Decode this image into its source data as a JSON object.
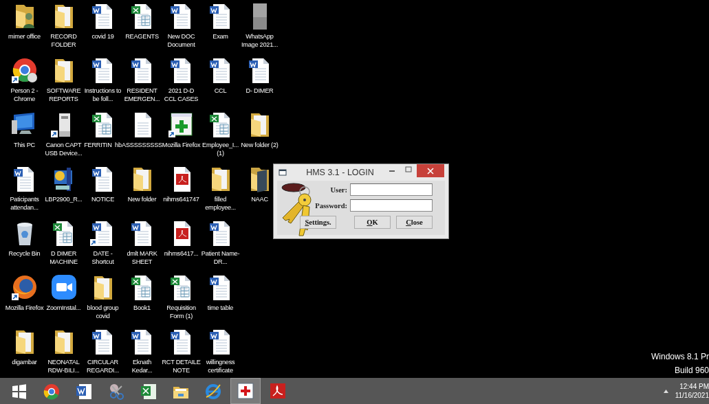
{
  "desktop": {
    "rows": [
      [
        {
          "label": "mimer office",
          "kind": "user-folder",
          "shortcut": false
        },
        {
          "label": "RECORD FOLDER",
          "kind": "folder",
          "shortcut": false
        },
        {
          "label": "covid 19",
          "kind": "word",
          "shortcut": false
        },
        {
          "label": "REAGENTS",
          "kind": "excel",
          "shortcut": false
        },
        {
          "label": "New DOC Document",
          "kind": "word",
          "shortcut": false
        },
        {
          "label": "Exam",
          "kind": "word",
          "shortcut": false
        },
        {
          "label": "WhatsApp Image 2021...",
          "kind": "photo",
          "shortcut": false
        }
      ],
      [
        {
          "label": "Person 2 - Chrome",
          "kind": "chrome",
          "shortcut": true
        },
        {
          "label": "SOFTWARE REPORTS",
          "kind": "folder",
          "shortcut": false
        },
        {
          "label": "Instructions to be foll...",
          "kind": "word",
          "shortcut": false
        },
        {
          "label": "RESIDENT EMERGEN...",
          "kind": "word",
          "shortcut": false
        },
        {
          "label": "2021 D-D CCL CASES",
          "kind": "word",
          "shortcut": false
        },
        {
          "label": "CCL",
          "kind": "word",
          "shortcut": false
        },
        {
          "label": "D- DIMER",
          "kind": "word",
          "shortcut": false
        }
      ],
      [
        {
          "label": "This PC",
          "kind": "computer",
          "shortcut": false
        },
        {
          "label": "Canon CAPT USB Device...",
          "kind": "printer",
          "shortcut": true
        },
        {
          "label": "FERRITIN  hb",
          "kind": "excel",
          "shortcut": false
        },
        {
          "label": "ASSSSSSSSS",
          "kind": "blank",
          "shortcut": false
        },
        {
          "label": "Mozilla Firefox",
          "kind": "cross-app",
          "shortcut": true
        },
        {
          "label": "Employee_I... (1)",
          "kind": "excel",
          "shortcut": false
        },
        {
          "label": "New folder (2)",
          "kind": "folder",
          "shortcut": false
        }
      ],
      [
        {
          "label": "Paticipants attendan...",
          "kind": "word",
          "shortcut": false
        },
        {
          "label": "LBP2900_R...",
          "kind": "installer",
          "shortcut": false
        },
        {
          "label": "NOTICE",
          "kind": "word",
          "shortcut": false
        },
        {
          "label": "New folder",
          "kind": "folder",
          "shortcut": false
        },
        {
          "label": "nihms641747",
          "kind": "pdf",
          "shortcut": false
        },
        {
          "label": "filled employee...",
          "kind": "folder",
          "shortcut": false
        },
        {
          "label": "NAAC",
          "kind": "dark-folder",
          "shortcut": false
        }
      ],
      [
        {
          "label": "Recycle Bin",
          "kind": "recycle",
          "shortcut": false
        },
        {
          "label": "D DIMER MACHINE",
          "kind": "excel",
          "shortcut": false
        },
        {
          "label": "DATE - Shortcut",
          "kind": "word",
          "shortcut": true
        },
        {
          "label": "dmlt MARK SHEET",
          "kind": "word",
          "shortcut": false
        },
        {
          "label": "nihms6417...",
          "kind": "pdf",
          "shortcut": false
        },
        {
          "label": "Patient Name- DR...",
          "kind": "word",
          "shortcut": false
        }
      ],
      [
        {
          "label": "Mozilla Firefox",
          "kind": "firefox",
          "shortcut": true
        },
        {
          "label": "ZoomInstal...",
          "kind": "zoom",
          "shortcut": false
        },
        {
          "label": "blood group covid",
          "kind": "folder",
          "shortcut": false
        },
        {
          "label": "Book1",
          "kind": "excel",
          "shortcut": false
        },
        {
          "label": "Requisition Form (1)",
          "kind": "excel",
          "shortcut": false
        },
        {
          "label": "time table",
          "kind": "word",
          "shortcut": false
        }
      ],
      [
        {
          "label": "digambar",
          "kind": "folder",
          "shortcut": false
        },
        {
          "label": "NEONATAL RDW-BILI...",
          "kind": "folder",
          "shortcut": false
        },
        {
          "label": "CIRCULAR REGARDI...",
          "kind": "word",
          "shortcut": false
        },
        {
          "label": "Eknath Kedar...",
          "kind": "word",
          "shortcut": false
        },
        {
          "label": "RCT DETAILE NOTE",
          "kind": "word",
          "shortcut": false
        },
        {
          "label": "willingness certificate",
          "kind": "word",
          "shortcut": false
        }
      ]
    ]
  },
  "login_window": {
    "title": "HMS 3.1 - LOGIN",
    "user_label": "User:",
    "password_label": "Password:",
    "buttons": [
      "Settings.",
      "OK",
      "Close"
    ]
  },
  "windows_watermark": [
    "Windows 8.1 Pr",
    "Build 960"
  ],
  "taskbar": {
    "items": [
      {
        "kind": "start",
        "selected": false
      },
      {
        "kind": "chrome",
        "selected": false
      },
      {
        "kind": "word",
        "selected": false
      },
      {
        "kind": "scissors",
        "selected": false
      },
      {
        "kind": "excel",
        "selected": false
      },
      {
        "kind": "explorer",
        "selected": false
      },
      {
        "kind": "ie",
        "selected": false
      },
      {
        "kind": "hms",
        "selected": true
      },
      {
        "kind": "acrobat",
        "selected": false
      }
    ],
    "time": "12:44 PM",
    "date": "11/16/2021"
  }
}
